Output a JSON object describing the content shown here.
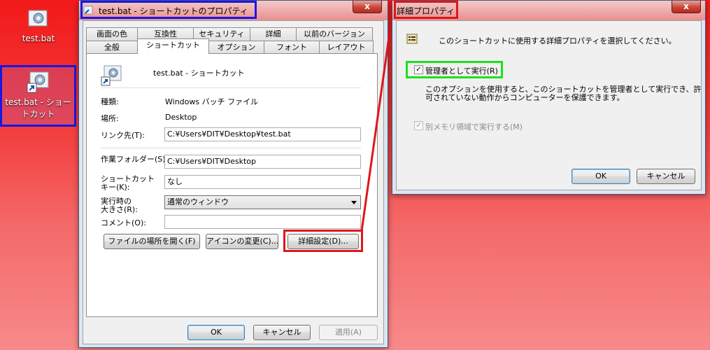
{
  "desktop": {
    "icon1_label": "test.bat",
    "icon2_label": "test.bat - ショートカット"
  },
  "props": {
    "title": "test.bat - ショートカットのプロパティ",
    "close_label": "x",
    "tabs_row1": [
      "画面の色",
      "互換性",
      "セキュリティ",
      "詳細",
      "以前のバージョン"
    ],
    "tabs_row2": [
      "全般",
      "ショートカット",
      "オプション",
      "フォント",
      "レイアウト"
    ],
    "header_name": "test.bat - ショートカット",
    "type_label": "種類:",
    "type_value": "Windows バッチ ファイル",
    "location_label": "場所:",
    "location_value": "Desktop",
    "target_label": "リンク先(T):",
    "target_value": "C:¥Users¥DIT¥Desktop¥test.bat",
    "workdir_label": "作業フォルダー(S):",
    "workdir_value": "C:¥Users¥DIT¥Desktop",
    "hotkey_label_1": "ショートカット",
    "hotkey_label_2": "キー(K):",
    "hotkey_value": "なし",
    "run_label_1": "実行時の",
    "run_label_2": "大きさ(R):",
    "run_value": "通常のウィンドウ",
    "comment_label": "コメント(O):",
    "comment_value": "",
    "btn_open_location": "ファイルの場所を開く(F)",
    "btn_change_icon": "アイコンの変更(C)...",
    "btn_advanced": "詳細設定(D)...",
    "btn_ok": "OK",
    "btn_cancel": "キャンセル",
    "btn_apply": "適用(A)"
  },
  "advanced": {
    "title": "詳細プロパティ",
    "close_label": "x",
    "intro": "このショートカットに使用する詳細プロパティを選択してください。",
    "run_as_admin": "管理者として実行(R)",
    "desc_line1": "このオプションを使用すると、このショートカットを管理者として実行でき、許",
    "desc_line2": "可されていない動作からコンピューターを保護できます。",
    "separate_memory": "別メモリ領域で実行する(M)",
    "check_mark": "✓",
    "btn_ok": "OK",
    "btn_cancel": "キャンセル"
  }
}
